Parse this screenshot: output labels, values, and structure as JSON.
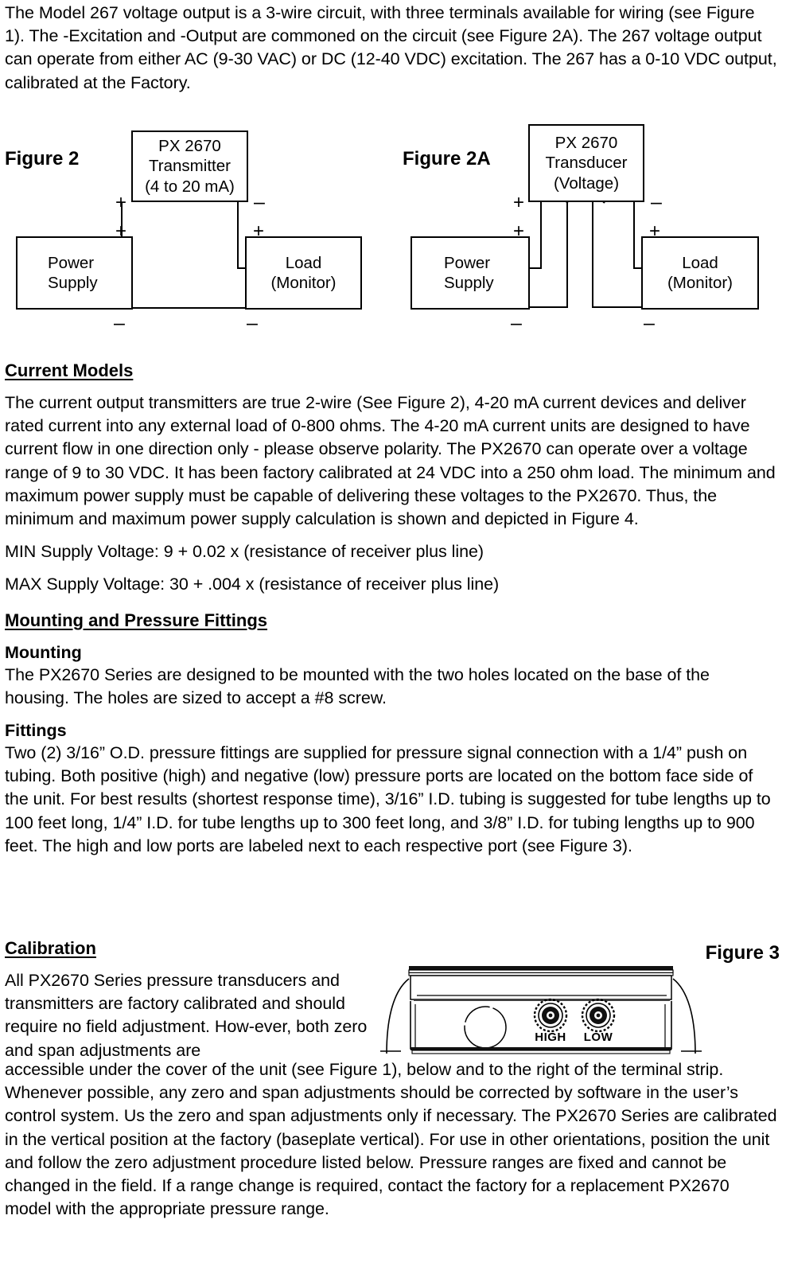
{
  "document": {
    "intro_paragraph": "The Model 267 voltage output is a 3-wire circuit, with three terminals available for wiring (see Figure 1).  The -Excitation and -Output are commoned on the circuit (see Figure 2A).  The 267 voltage output can operate from either AC (9-30 VAC) or DC (12-40 VDC) excitation.  The 267 has a 0-10 VDC output, calibrated at the Factory."
  },
  "figure2": {
    "caption": "Figure 2",
    "device_box": {
      "line1": "PX 2670",
      "line2": "Transmitter",
      "line3": "(4 to 20 mA)"
    },
    "power_supply_box": {
      "line1": "Power",
      "line2": "Supply"
    },
    "load_box": {
      "line1": "Load",
      "line2": "(Monitor)"
    },
    "signs": {
      "device_plus": "+",
      "device_minus": "–",
      "supply_plus": "+",
      "supply_minus": "–",
      "load_plus": "+",
      "load_minus": "–"
    }
  },
  "figure2a": {
    "caption": "Figure 2A",
    "device_box": {
      "line1": "PX 2670",
      "line2": "Transducer",
      "line3": "(Voltage)"
    },
    "power_supply_box": {
      "line1": "Power",
      "line2": "Supply"
    },
    "load_box": {
      "line1": "Load",
      "line2": "(Monitor)"
    },
    "signs": {
      "device_plus": "+",
      "device_minus": "–",
      "supply_plus": "+",
      "supply_minus": "–",
      "load_plus": "+",
      "load_minus": "–"
    }
  },
  "sections": {
    "current_models": {
      "heading": "Current Models",
      "paragraph": "The current output transmitters are true 2-wire (See Figure 2), 4-20 mA current devices and deliver rated current into any external load of 0-800 ohms.  The 4-20 mA current units are designed to have current flow in one direction only - please observe polarity.  The PX2670 can operate over a voltage range of 9 to 30 VDC.  It has been factory calibrated at 24 VDC into a 250 ohm load.  The minimum and maximum power supply must be capable of delivering these voltages to the PX2670.  Thus, the",
      "paragraph_cont": "minimum and maximum power supply calculation is shown and depicted in Figure 4.",
      "min_supply": "MIN Supply Voltage: 9 + 0.02 x (resistance of receiver plus line)",
      "max_supply": "MAX Supply Voltage: 30 + .004 x (resistance of receiver plus line)"
    },
    "mounting_and_fittings": {
      "heading": "Mounting and Pressure Fittings",
      "mounting_subheading": "Mounting",
      "mounting_paragraph": "The PX2670 Series are designed to be mounted with the two holes located on the base of the housing.  The holes are sized to accept a #8 screw.",
      "fittings_subheading": "Fittings",
      "fittings_paragraph": "Two (2) 3/16” O.D. pressure fittings are supplied for pressure signal connection with a 1/4” push on tubing.  Both positive (high) and negative (low) pressure ports are located on the bottom face side of the unit.  For best results (shortest response time), 3/16” I.D. tubing is suggested for tube lengths up to 100 feet long, 1/4” I.D. for tube lengths up to 300 feet long, and 3/8” I.D. for tubing lengths up to 900 feet.  The high and low ports are labeled next to each respective port (see Figure 3)."
    },
    "calibration": {
      "heading": "Calibration",
      "wrapped_paragraph": "All PX2670 Series pressure transducers and transmitters are factory calibrated and should require no field adjustment.  How-ever, both zero and span adjustments are",
      "continued_paragraph": "accessible under the cover of the unit (see Figure 1), below and to the right of the terminal strip.  Whenever possible, any zero and span adjustments should be corrected by software in the user’s control system. Us the zero and span adjustments only if necessary.  The PX2670 Series are calibrated in the vertical position at the factory (baseplate vertical).  For use in other orientations, position the unit and follow the zero adjustment procedure listed below.  Pressure ranges are fixed and cannot be changed in the field.  If a range change is required, contact the factory for a replacement PX2670 model with the appropriate pressure range."
    }
  },
  "figure3": {
    "caption": "Figure 3",
    "port_label_high": "HIGH",
    "port_label_low": "LOW"
  }
}
